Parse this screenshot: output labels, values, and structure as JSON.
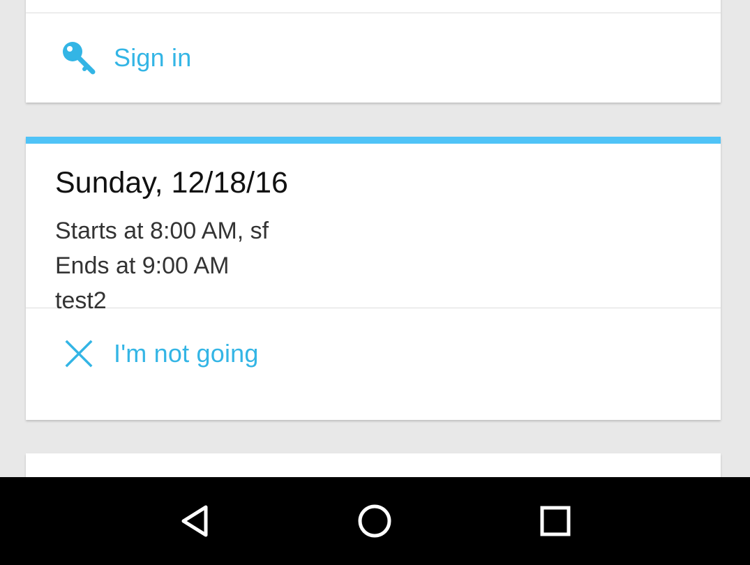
{
  "signin_card": {
    "label": "Sign in",
    "icon": "key-icon"
  },
  "event_card": {
    "accent_color": "#4fc3f7",
    "date": "Sunday, 12/18/16",
    "starts": "Starts at 8:00 AM, sf",
    "ends": "Ends at 9:00 AM",
    "title": "test2",
    "action_label": "I'm not going",
    "action_icon": "close-icon"
  },
  "colors": {
    "link": "#33b5e5",
    "background": "#e8e8e8",
    "navbar": "#000000"
  },
  "navbar": {
    "buttons": [
      "back-icon",
      "home-icon",
      "recents-icon"
    ]
  }
}
